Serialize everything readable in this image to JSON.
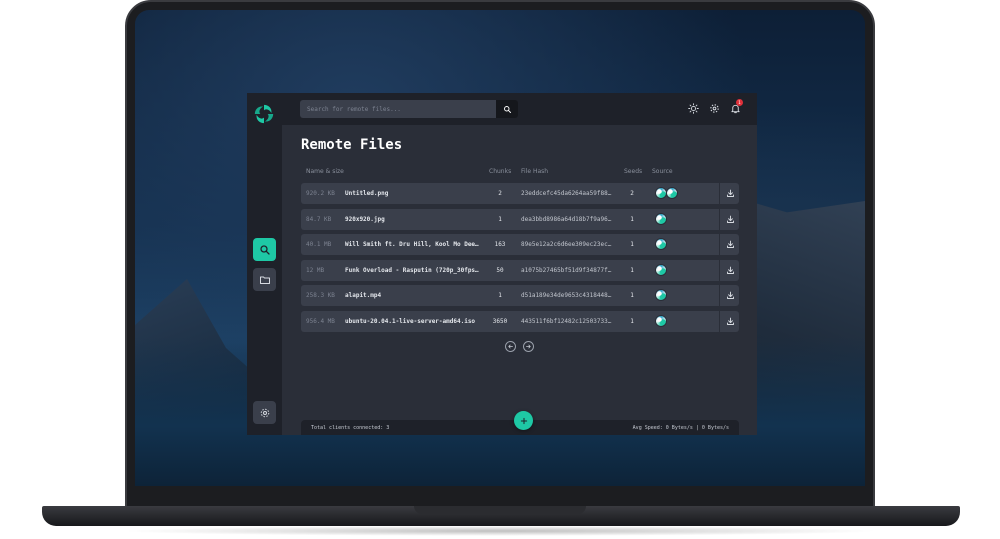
{
  "search": {
    "placeholder": "Search for remote files..."
  },
  "page": {
    "title": "Remote Files"
  },
  "columns": {
    "name_size": "Name & size",
    "chunks": "Chunks",
    "file_hash": "File Hash",
    "seeds": "Seeds",
    "source": "Source"
  },
  "files": [
    {
      "size": "920.2 KB",
      "name": "Untitled.png",
      "chunks": "2",
      "hash": "23eddcefc45da6264aa59f883...",
      "seeds": "2",
      "source_count": 2
    },
    {
      "size": "84.7 KB",
      "name": "920x920.jpg",
      "chunks": "1",
      "hash": "dea3bbd8986a64d18b7f9a96b...",
      "seeds": "1",
      "source_count": 1
    },
    {
      "size": "40.1 MB",
      "name": "Will Smith ft. Dru Hill, Kool Mo Dee...",
      "chunks": "163",
      "hash": "89e5e12a2c6d6ee309ec23ec7...",
      "seeds": "1",
      "source_count": 1
    },
    {
      "size": "12 MB",
      "name": "Funk Overload - Rasputin (720p_30fps_...",
      "chunks": "50",
      "hash": "a1075b27465bf51d9f34877f4...",
      "seeds": "1",
      "source_count": 1
    },
    {
      "size": "258.3 KB",
      "name": "alapit.mp4",
      "chunks": "1",
      "hash": "d51a189e34de9653c43184486...",
      "seeds": "1",
      "source_count": 1
    },
    {
      "size": "956.4 MB",
      "name": "ubuntu-20.04.1-live-server-amd64.iso",
      "chunks": "3650",
      "hash": "443511f6bf12482c125037330...",
      "seeds": "1",
      "source_count": 1
    }
  ],
  "footer": {
    "clients": "Total clients connected: 3",
    "speed": "Avg Speed: 0 Bytes/s | 0 Bytes/s"
  },
  "notifications": {
    "count": "1"
  },
  "colors": {
    "accent": "#1ec8a5",
    "panel": "#2a2e38",
    "sidebar": "#1e2129",
    "row": "#3a3f4b",
    "badge": "#e0303a"
  },
  "icons": {
    "logo": "swirl-logo-icon",
    "search": "search-icon",
    "files": "folder-icon",
    "settings": "gear-icon",
    "theme": "sun-icon",
    "notifications": "bell-icon",
    "download": "download-icon",
    "prev": "arrow-left-circle-icon",
    "next": "arrow-right-circle-icon",
    "add": "plus-icon"
  }
}
